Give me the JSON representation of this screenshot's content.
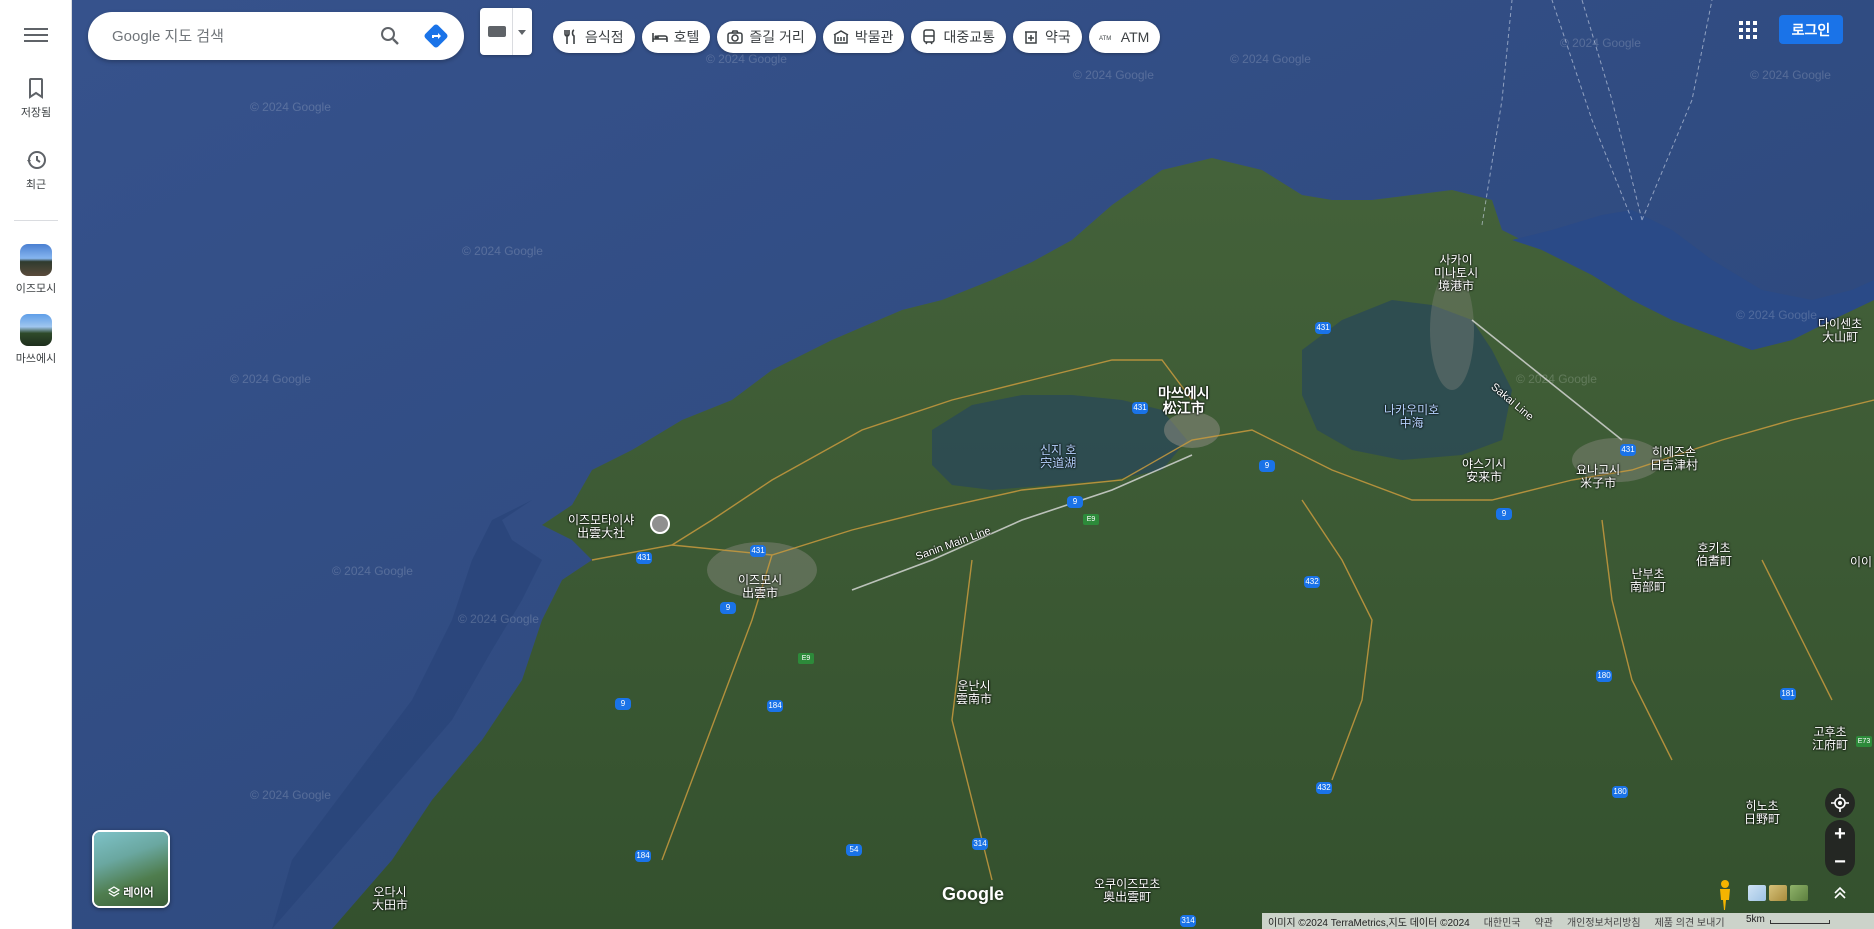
{
  "search": {
    "placeholder": "Google 지도 검색"
  },
  "sidebar": {
    "items": [
      {
        "label": "저장됨",
        "icon": "bookmark-icon"
      },
      {
        "label": "최근",
        "icon": "history-icon"
      },
      {
        "label": "이즈모시",
        "icon": "thumbnail-izumo"
      },
      {
        "label": "마쓰에시",
        "icon": "thumbnail-matsue"
      }
    ]
  },
  "chips": [
    {
      "label": "음식점",
      "icon": "restaurant-icon"
    },
    {
      "label": "호텔",
      "icon": "hotel-icon"
    },
    {
      "label": "즐길 거리",
      "icon": "camera-icon"
    },
    {
      "label": "박물관",
      "icon": "museum-icon"
    },
    {
      "label": "대중교통",
      "icon": "transit-icon"
    },
    {
      "label": "약국",
      "icon": "pharmacy-icon"
    },
    {
      "label": "ATM",
      "icon": "atm-icon"
    }
  ],
  "header": {
    "login_label": "로그인"
  },
  "layers": {
    "label": "레이어"
  },
  "map": {
    "logo": "Google",
    "watermark": "© 2024 Google",
    "labels": [
      {
        "text": "마쓰에시\n松江市",
        "kind": "big"
      },
      {
        "text": "이즈모타이샤\n出雲大社",
        "kind": "poi"
      },
      {
        "text": "이즈모시\n出雲市",
        "kind": "city"
      },
      {
        "text": "신지 호\n宍道湖",
        "kind": "water"
      },
      {
        "text": "나카우미호\n中海",
        "kind": "water"
      },
      {
        "text": "사카이\n미나토시\n境港市",
        "kind": "city"
      },
      {
        "text": "야스기시\n安来市",
        "kind": "city"
      },
      {
        "text": "요나고시\n米子市",
        "kind": "city"
      },
      {
        "text": "히에즈손\n日吉津村",
        "kind": "city"
      },
      {
        "text": "다이센초\n大山町",
        "kind": "city"
      },
      {
        "text": "운난시\n雲南市",
        "kind": "city"
      },
      {
        "text": "호키초\n伯耆町",
        "kind": "city"
      },
      {
        "text": "난부초\n南部町",
        "kind": "city"
      },
      {
        "text": "고후초\n江府町",
        "kind": "city"
      },
      {
        "text": "히노초\n日野町",
        "kind": "city"
      },
      {
        "text": "오쿠이즈모초\n奥出雲町",
        "kind": "city"
      },
      {
        "text": "오다시\n大田市",
        "kind": "city"
      },
      {
        "text": "Sanin Main Line",
        "kind": "rail"
      },
      {
        "text": "Sakai Line",
        "kind": "rail"
      },
      {
        "text": "이이",
        "kind": "city"
      }
    ],
    "route_shields": [
      "431",
      "431",
      "431",
      "431",
      "431",
      "9",
      "9",
      "9",
      "9",
      "9",
      "432",
      "432",
      "184",
      "184",
      "54",
      "314",
      "314",
      "180",
      "180",
      "181"
    ],
    "expressway_shields": [
      "E9",
      "E9",
      "E73"
    ]
  },
  "footer": {
    "attribution": "이미지 ©2024 TerraMetrics,지도 데이터 ©2024",
    "country": "대한민국",
    "terms": "약관",
    "privacy": "개인정보처리방침",
    "feedback": "제품 의견 보내기",
    "scale": "5km"
  },
  "colors": {
    "sea": "#2f4b84",
    "land": "#3d5a33",
    "accent": "#1a73e8"
  }
}
